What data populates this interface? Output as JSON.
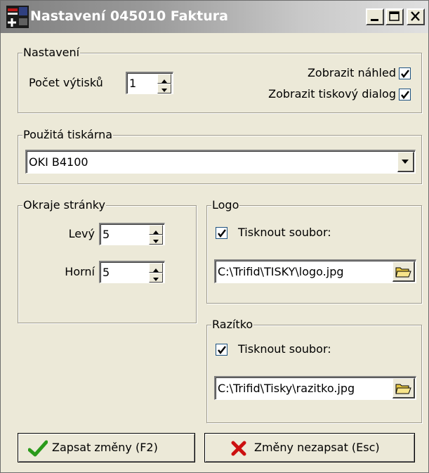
{
  "window": {
    "title": "Nastavení 045010 Faktura",
    "controls": [
      "minimize",
      "maximize",
      "close"
    ]
  },
  "nastaveni": {
    "legend": "Nastavení",
    "copies_label": "Počet výtisků",
    "copies_value": "1",
    "preview_label": "Zobrazit náhled",
    "preview_checked": true,
    "print_dialog_label": "Zobrazit tiskový dialog",
    "print_dialog_checked": true
  },
  "printer": {
    "legend": "Použitá tiskárna",
    "selected": "OKI B4100"
  },
  "margins": {
    "legend": "Okraje stránky",
    "left_label": "Levý",
    "left_value": "5",
    "top_label": "Horní",
    "top_value": "5"
  },
  "logo": {
    "legend": "Logo",
    "print_file_label": "Tisknout soubor:",
    "print_file_checked": true,
    "path": "C:\\Trifid\\TISKY\\logo.jpg"
  },
  "stamp": {
    "legend": "Razítko",
    "print_file_label": "Tisknout soubor:",
    "print_file_checked": true,
    "path": "C:\\Trifid\\Tisky\\razitko.jpg"
  },
  "buttons": {
    "save_label": "Zapsat změny (F2)",
    "cancel_label": "Změny nezapsat (Esc)"
  },
  "colors": {
    "save_icon": "#2a9a1a",
    "cancel_icon": "#cc1010",
    "folder_icon": "#e8c840"
  }
}
